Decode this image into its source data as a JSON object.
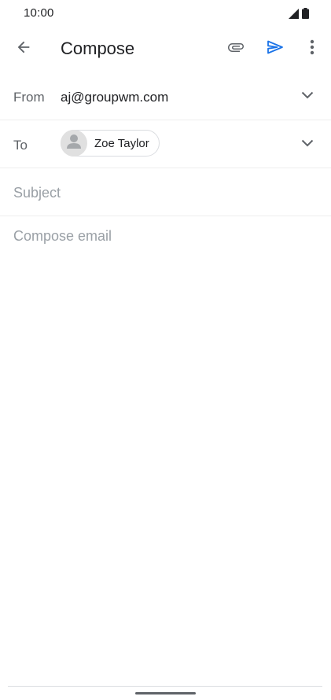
{
  "status_bar": {
    "time": "10:00",
    "icons": [
      "signal-icon",
      "battery-icon"
    ]
  },
  "app_bar": {
    "title": "Compose",
    "icons": {
      "back": "arrow-back-icon",
      "attach": "paperclip-icon",
      "send": "send-icon",
      "more": "more-vert-icon"
    },
    "send_color": "#1a73e8"
  },
  "from": {
    "label": "From",
    "value": "aj@groupwm.com"
  },
  "to": {
    "label": "To",
    "recipients": [
      {
        "name": "Zoe Taylor",
        "avatar_icon": "person-icon"
      }
    ]
  },
  "subject": {
    "placeholder": "Subject",
    "value": ""
  },
  "body": {
    "placeholder": "Compose email",
    "value": ""
  }
}
